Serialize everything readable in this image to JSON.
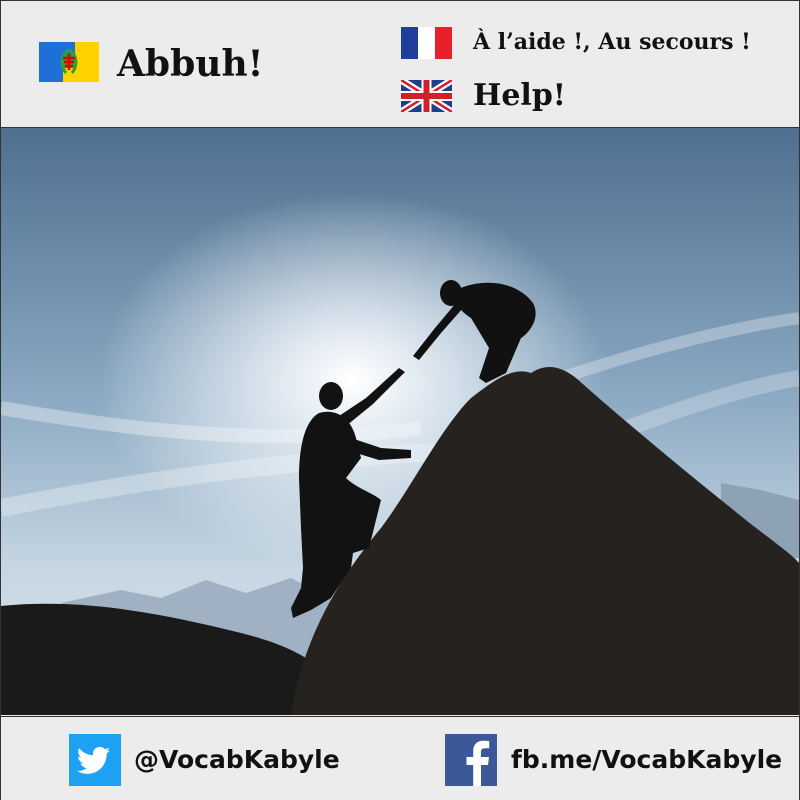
{
  "header": {
    "kabyle": {
      "flag_icon": "kabyle-flag-icon",
      "word": "Abbuh!"
    },
    "french": {
      "flag_icon": "france-flag-icon",
      "word": "À l’aide !, Au secours !"
    },
    "english": {
      "flag_icon": "uk-flag-icon",
      "word": "Help!"
    }
  },
  "photo": {
    "subject": "silhouette of a person helping another climb a rock against the sky"
  },
  "footer": {
    "twitter": {
      "icon": "twitter-bird-icon",
      "handle": "@VocabKabyle",
      "brand_color": "#1da1f2"
    },
    "facebook": {
      "icon": "facebook-f-icon",
      "handle": "fb.me/VocabKabyle",
      "brand_color": "#3b5998"
    }
  },
  "colors": {
    "background": "#ececec",
    "text": "#111111",
    "kabyle_blue": "#1e6fd6",
    "kabyle_yellow": "#ffd200",
    "kabyle_red": "#e00000"
  }
}
